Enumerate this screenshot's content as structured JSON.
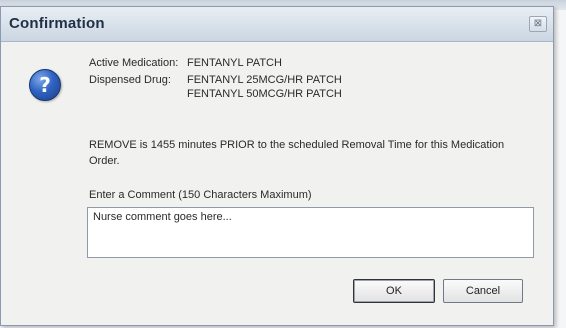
{
  "dialog": {
    "title": "Confirmation",
    "close_glyph": "⊠",
    "icon": "question-icon",
    "icon_glyph": "?"
  },
  "medication": {
    "active_label": "Active Medication:",
    "active_value": "FENTANYL PATCH",
    "dispensed_label": "Dispensed Drug:",
    "dispensed_values": [
      "FENTANYL 25MCG/HR PATCH",
      "FENTANYL 50MCG/HR PATCH"
    ]
  },
  "message": "REMOVE is 1455 minutes PRIOR to the scheduled Removal Time for this Medication Order.",
  "comment": {
    "label": "Enter a Comment  (150 Characters Maximum)",
    "value": "Nurse comment goes here..."
  },
  "buttons": {
    "ok": "OK",
    "cancel": "Cancel"
  },
  "colors": {
    "icon_blue": "#2f63c2",
    "title_text": "#1f2f45"
  }
}
